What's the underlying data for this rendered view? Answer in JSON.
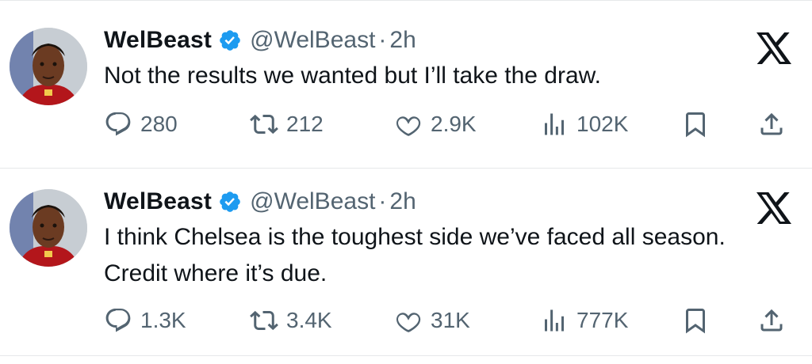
{
  "tweets": [
    {
      "author_name": "WelBeast",
      "handle": "@WelBeast",
      "separator": "·",
      "time": "2h",
      "text": "Not the results we wanted but I’ll take the draw.",
      "replies": "280",
      "retweets": "212",
      "likes": "2.9K",
      "views": "102K",
      "avatar_icon": "player-avatar",
      "logo_icon": "x-logo-icon"
    },
    {
      "author_name": "WelBeast",
      "handle": "@WelBeast",
      "separator": "·",
      "time": "2h",
      "text": "I think Chelsea is the toughest side we’ve faced all season. Credit where it’s due.",
      "replies": "1.3K",
      "retweets": "3.4K",
      "likes": "31K",
      "views": "777K",
      "avatar_icon": "player-avatar",
      "logo_icon": "x-logo-icon"
    }
  ],
  "colors": {
    "text": "#0f1419",
    "secondary": "#536471",
    "verified_blue": "#1d9bf0",
    "divider": "#e6e8ea"
  }
}
